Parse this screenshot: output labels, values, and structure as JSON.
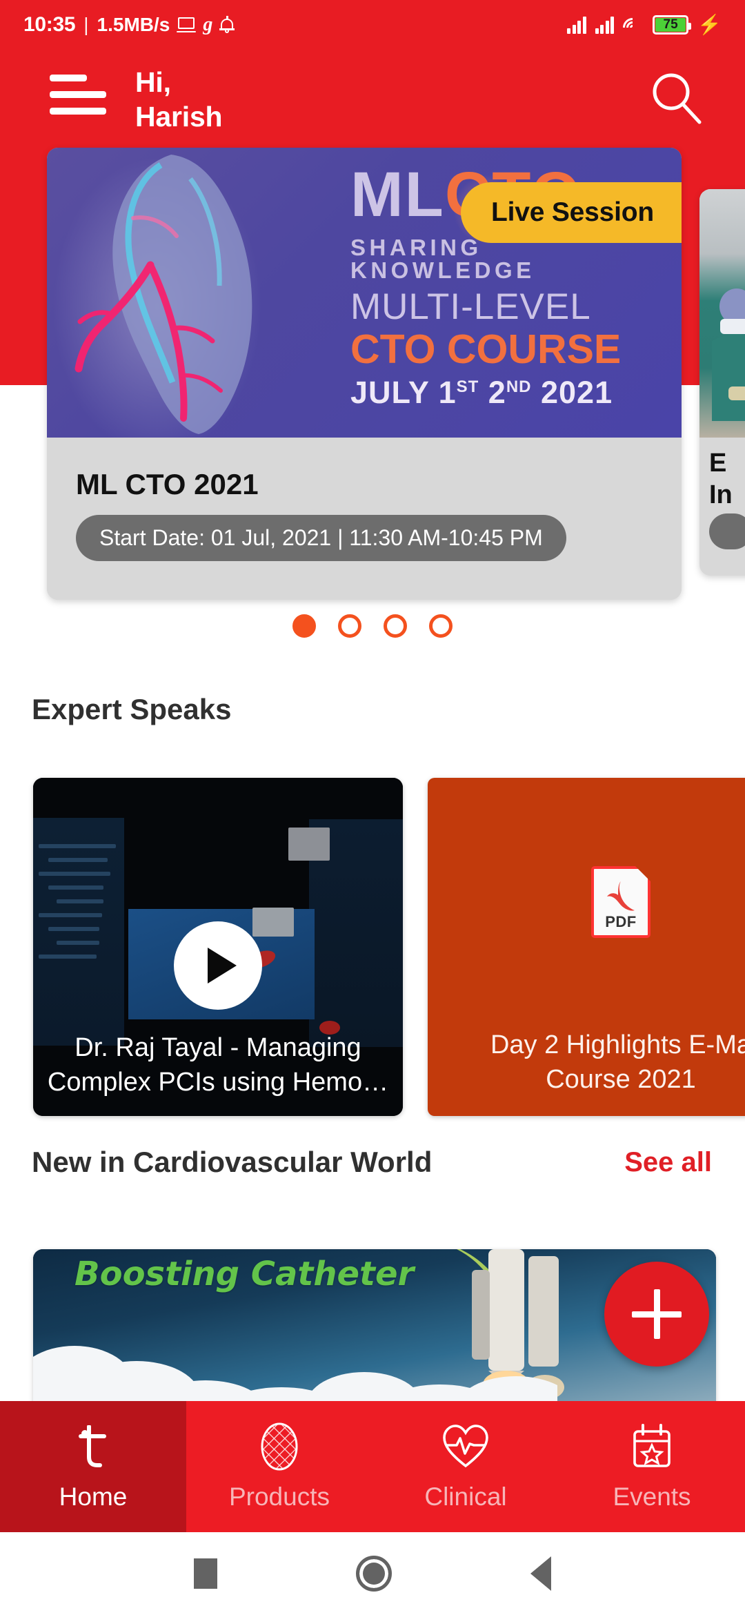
{
  "status_bar": {
    "time": "10:35",
    "separator": "|",
    "network_speed": "1.5MB/s",
    "icons": [
      "laptop-cast-icon",
      "g-app-icon",
      "notification-bell-icon"
    ],
    "signal_1": "signal-bars-icon",
    "signal_2": "signal-bars-icon",
    "wifi": "wifi-icon",
    "battery_percent": "75",
    "charging": "⚡",
    "battery_fill_color": "#4CD137"
  },
  "header": {
    "menu_icon": "hamburger-menu-icon",
    "greeting_line1": "Hi,",
    "greeting_line2": "Harish",
    "search_icon": "search-icon",
    "background_color": "#E81C23"
  },
  "carousel": {
    "badge_label": "Live Session",
    "badge_color": "#F5B928",
    "banner": {
      "logo_ml": "ML",
      "logo_cto": "CTO",
      "tagline": "SHARING KNOWLEDGE",
      "line_multilevel": "MULTI-LEVEL",
      "line_course": "CTO COURSE",
      "line_dates": "JULY 1",
      "dates_sup1": "ST",
      "dates_mid": " 2",
      "dates_sup2": "ND",
      "dates_year": " 2021"
    },
    "title": "ML CTO 2021",
    "date_pill": "Start Date: 01 Jul, 2021 | 11:30 AM-10:45 PM",
    "peek_title_line1": "E",
    "peek_title_line2": "In",
    "dots": [
      {
        "active": true
      },
      {
        "active": false
      },
      {
        "active": false
      },
      {
        "active": false
      }
    ],
    "dot_color": "#F4511E"
  },
  "expert_speaks": {
    "heading": "Expert Speaks",
    "cards": [
      {
        "type": "video",
        "play_icon": "play-button-icon",
        "caption_line1": "Dr. Raj Tayal - Managing",
        "caption_line2": "Complex PCIs using Hemo…"
      },
      {
        "type": "pdf",
        "file_icon": "pdf-file-icon",
        "file_label": "PDF",
        "caption_line1": "Day 2 Highlights E-Ma",
        "caption_line2": "Course 2021",
        "background_color": "#C23A0C"
      }
    ]
  },
  "new_in_cv_world": {
    "heading": "New in Cardiovascular World",
    "see_all": "See all",
    "see_all_color": "#E01F26",
    "article_title": "Boosting Catheter",
    "article_title_color": "#63C44A"
  },
  "fab": {
    "icon": "plus-icon",
    "color": "#E11B22"
  },
  "bottom_nav": {
    "items": [
      {
        "label": "Home",
        "icon": "terumo-logo-icon",
        "active": true
      },
      {
        "label": "Products",
        "icon": "stent-mesh-icon",
        "active": false
      },
      {
        "label": "Clinical",
        "icon": "heart-pulse-icon",
        "active": false
      },
      {
        "label": "Events",
        "icon": "calendar-star-icon",
        "active": false
      }
    ],
    "background_color": "#ED1C24",
    "active_background_color": "#B8141B"
  },
  "system_nav": {
    "recents": "square-recents-icon",
    "home": "circle-home-icon",
    "back": "triangle-back-icon"
  }
}
